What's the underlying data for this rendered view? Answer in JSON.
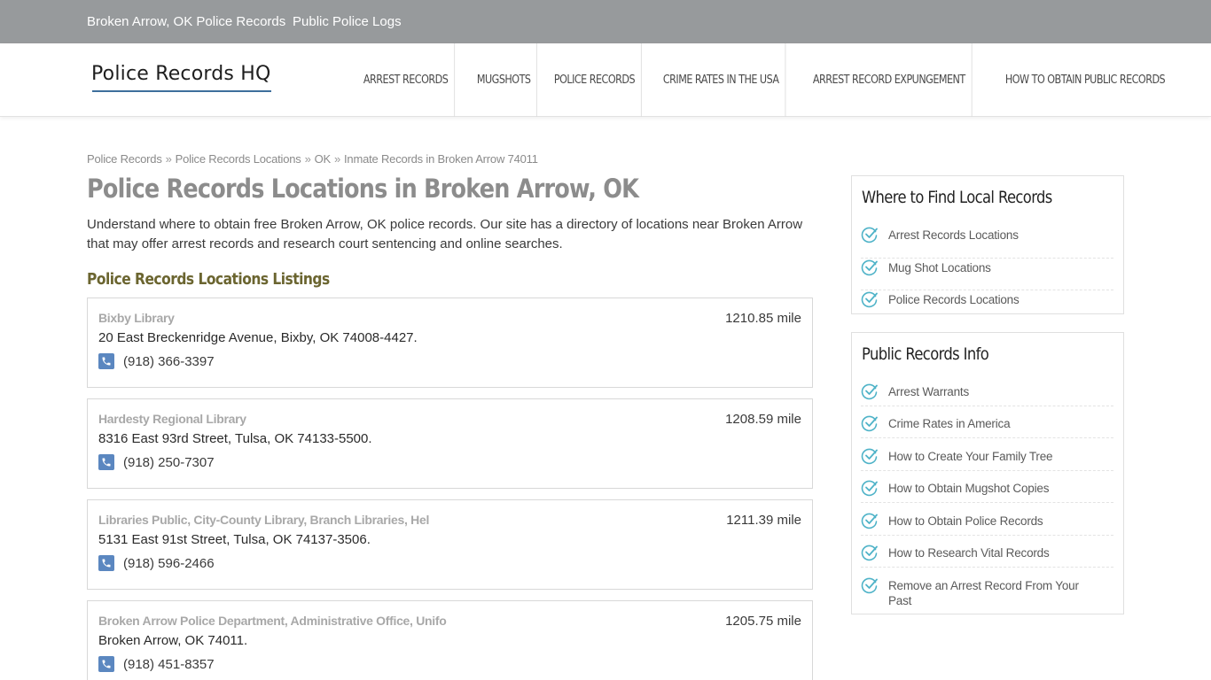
{
  "topbar": {
    "links": [
      "Broken Arrow, OK Police Records",
      "Public Police Logs"
    ]
  },
  "header": {
    "logo": "Police Records HQ",
    "nav": [
      "ARREST RECORDS",
      "MUGSHOTS",
      "POLICE RECORDS",
      "CRIME RATES IN THE USA",
      "ARREST RECORD EXPUNGEMENT",
      "HOW TO OBTAIN PUBLIC RECORDS"
    ]
  },
  "breadcrumb": [
    "Police Records",
    "Police Records Locations",
    "OK",
    "Inmate Records in Broken Arrow 74011"
  ],
  "breadcrumb_sep": "»",
  "main": {
    "title": "Police Records Locations in Broken Arrow, OK",
    "intro": "Understand where to obtain free Broken Arrow, OK police records. Our site has a directory of locations near Broken Arrow that may offer arrest records and research court sentencing and online searches.",
    "listings_title": "Police Records Locations Listings",
    "listings": [
      {
        "name": "Bixby Library",
        "distance": "1210.85 mile",
        "address": "20 East Breckenridge Avenue, Bixby, OK 74008-4427.",
        "phone": "(918) 366-3397"
      },
      {
        "name": "Hardesty Regional Library",
        "distance": "1208.59 mile",
        "address": "8316 East 93rd Street, Tulsa, OK 74133-5500.",
        "phone": "(918) 250-7307"
      },
      {
        "name": "Libraries Public, City-County Library, Branch Libraries, Hel",
        "distance": "1211.39 mile",
        "address": "5131 East 91st Street, Tulsa, OK 74137-3506.",
        "phone": "(918) 596-2466"
      },
      {
        "name": "Broken Arrow Police Department, Administrative Office, Unifo",
        "distance": "1205.75 mile",
        "address": "Broken Arrow, OK 74011.",
        "phone": "(918) 451-8357"
      }
    ]
  },
  "sidebar": {
    "local": {
      "title": "Where to Find Local Records",
      "items": [
        "Arrest Records Locations",
        "Mug Shot Locations",
        "Police Records Locations"
      ]
    },
    "info": {
      "title": "Public Records Info",
      "items": [
        "Arrest Warrants",
        "Crime Rates in America",
        "How to Create Your Family Tree",
        "How to Obtain Mugshot Copies",
        "How to Obtain Police Records",
        "How to Research Vital Records",
        "Remove an Arrest Record From Your Past"
      ]
    }
  },
  "colors": {
    "topbar": "#979a9c",
    "accent_blue": "#5b87c0",
    "check_teal": "#4fb3c8",
    "section_olive": "#6b6530"
  }
}
